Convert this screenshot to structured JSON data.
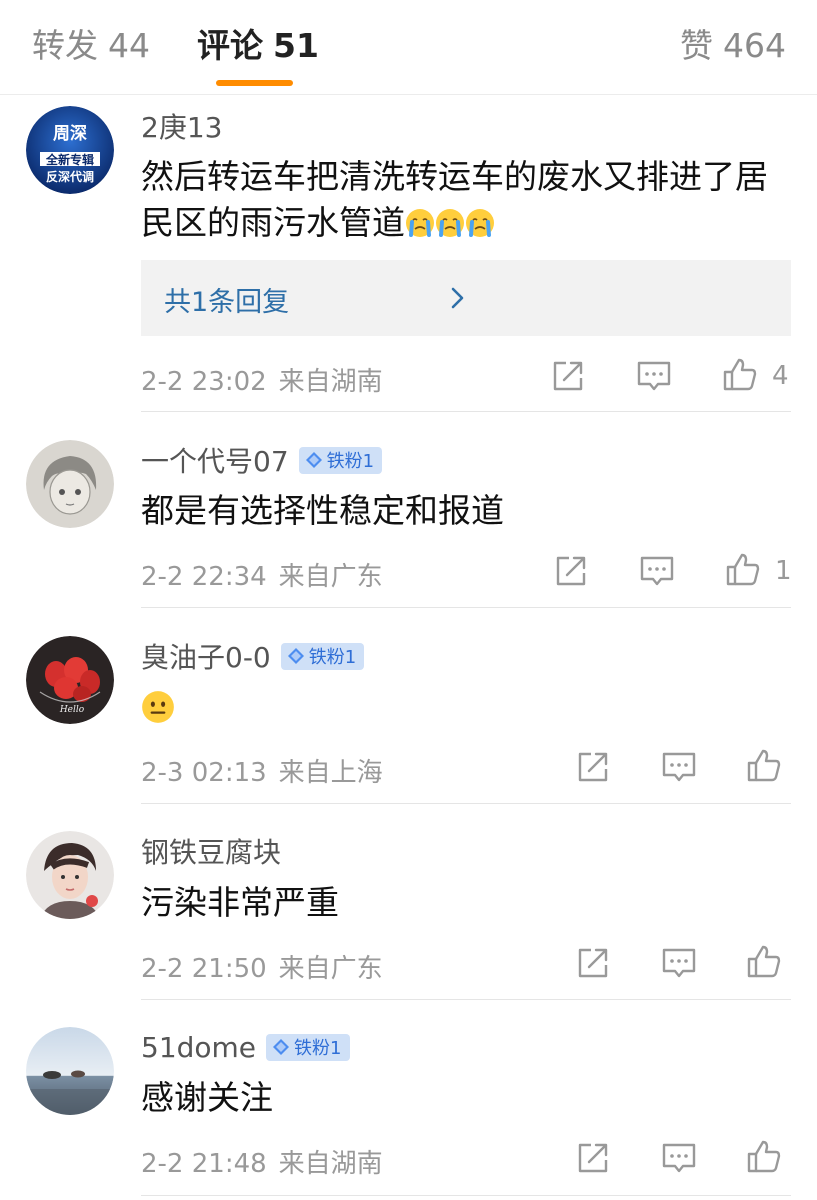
{
  "tabs": {
    "repost": {
      "label": "转发",
      "count": "44"
    },
    "comments": {
      "label": "评论",
      "count": "51"
    },
    "likes": {
      "label": "赞",
      "count": "464"
    }
  },
  "comments": [
    {
      "username": "2庚13",
      "avatar_text": [
        "周深",
        "全新专辑",
        "反深代调"
      ],
      "text": "然后转运车把清洗转运车的废水又排进了居民区的雨污水管道",
      "emojis": [
        "crying-emoji",
        "crying-emoji",
        "crying-emoji"
      ],
      "reply_link": "共1条回复",
      "time": "2-2 23:02",
      "location": "来自湖南",
      "like_count": "4"
    },
    {
      "username": "一个代号07",
      "badge": "铁粉1",
      "text": "都是有选择性稳定和报道",
      "time": "2-2 22:34",
      "location": "来自广东",
      "like_count": "1"
    },
    {
      "username": "臭油子0-0",
      "badge": "铁粉1",
      "avatar_text": "Hello",
      "text": "",
      "emoji": "neutral-face-emoji",
      "time": "2-3 02:13",
      "location": "来自上海"
    },
    {
      "username": "钢铁豆腐块",
      "text": "污染非常严重",
      "time": "2-2 21:50",
      "location": "来自广东"
    },
    {
      "username": "51dome",
      "badge": "铁粉1",
      "text": "感谢关注",
      "time": "2-2 21:48",
      "location": "来自湖南"
    }
  ],
  "icons": [
    "share-icon",
    "reply-icon",
    "like-icon",
    "chevron-right-icon",
    "diamond-icon"
  ],
  "colors": {
    "accent": "#ff8c00",
    "link": "#2e6fa8",
    "badge_bg": "#cfe0f7",
    "badge_text": "#2f6ed6"
  }
}
